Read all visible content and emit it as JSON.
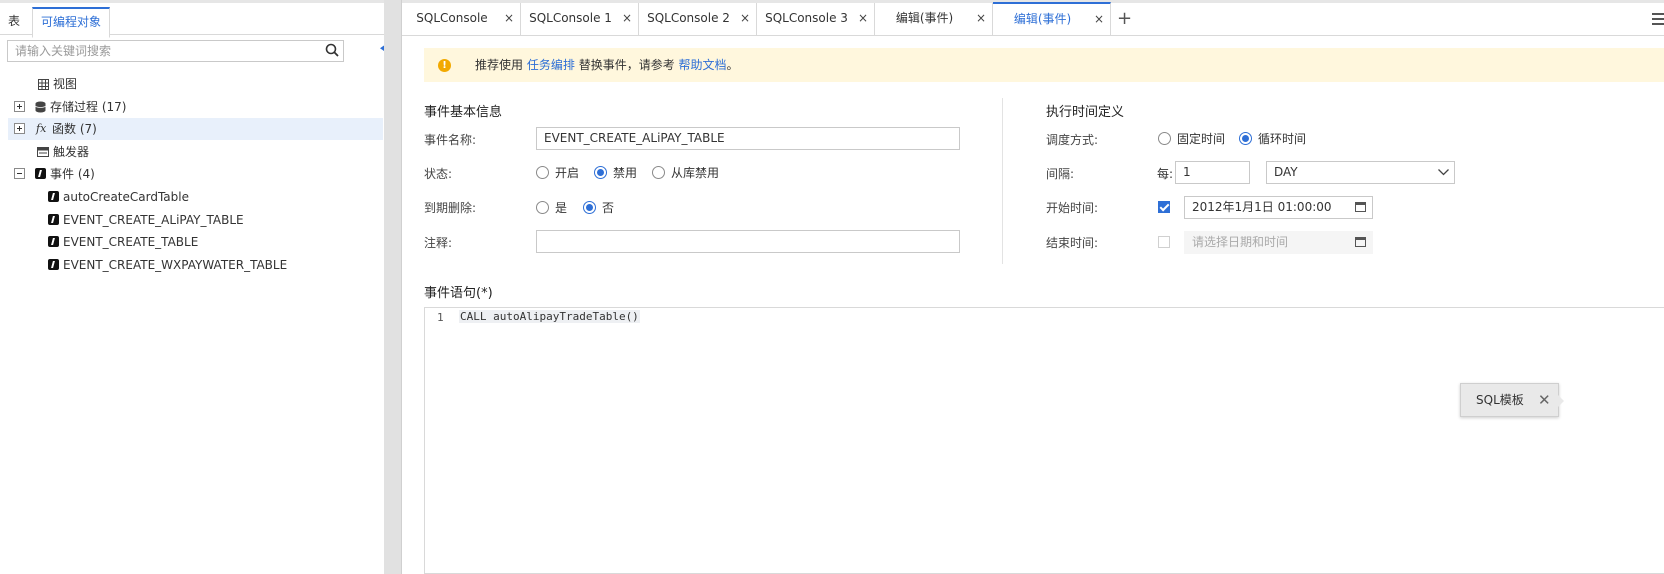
{
  "sidebar": {
    "tabs": [
      {
        "label": "表"
      },
      {
        "label": "可编程对象"
      }
    ],
    "search_placeholder": "请输入关键词搜索",
    "tree": [
      {
        "label": "视图"
      },
      {
        "label": "存储过程 (17)"
      },
      {
        "label": "函数 (7)"
      },
      {
        "label": "触发器"
      },
      {
        "label": "事件 (4)"
      },
      {
        "label": "autoCreateCardTable"
      },
      {
        "label": "EVENT_CREATE_ALiPAY_TABLE"
      },
      {
        "label": "EVENT_CREATE_TABLE"
      },
      {
        "label": "EVENT_CREATE_WXPAYWATER_TABLE"
      }
    ],
    "fx_glyph": "fx"
  },
  "tabs": [
    {
      "label": "SQLConsole",
      "close": "×"
    },
    {
      "label": "SQLConsole 1",
      "close": "×"
    },
    {
      "label": "SQLConsole 2",
      "close": "×"
    },
    {
      "label": "SQLConsole 3",
      "close": "×"
    },
    {
      "label": "编辑(事件)",
      "close": "×"
    },
    {
      "label": "编辑(事件)",
      "close": "×"
    }
  ],
  "add_tab": "+",
  "notice": {
    "icon": "!",
    "prefix": "推荐使用",
    "link1": "任务编排",
    "middle": "替换事件，请参考",
    "link2": "帮助文档",
    "suffix": "。"
  },
  "basic_info": {
    "title": "事件基本信息",
    "name_label": "事件名称:",
    "name_value": "EVENT_CREATE_ALiPAY_TABLE",
    "status_label": "状态:",
    "status_options": [
      "开启",
      "禁用",
      "从库禁用"
    ],
    "status_selected": "禁用",
    "expire_label": "到期删除:",
    "expire_options": [
      "是",
      "否"
    ],
    "expire_selected": "否",
    "comment_label": "注释:",
    "comment_value": ""
  },
  "schedule": {
    "title": "执行时间定义",
    "mode_label": "调度方式:",
    "mode_options": [
      "固定时间",
      "循环时间"
    ],
    "mode_selected": "循环时间",
    "interval_label": "间隔:",
    "every_label": "每:",
    "interval_value": "1",
    "interval_unit": "DAY",
    "start_label": "开始时间:",
    "start_checked": true,
    "start_value": "2012年1月1日 01:00:00",
    "end_label": "结束时间:",
    "end_checked": false,
    "end_placeholder": "请选择日期和时间"
  },
  "statement": {
    "title": "事件语句(*)",
    "line_number": "1",
    "code": "CALL autoAlipayTradeTable()"
  },
  "sql_template": {
    "label": "SQL模板",
    "close": "✕"
  },
  "colors": {
    "accent": "#2e6fd6",
    "notice_bg": "#fff7dd",
    "warn": "#f2a900",
    "selected_row": "#e8f0fb"
  }
}
